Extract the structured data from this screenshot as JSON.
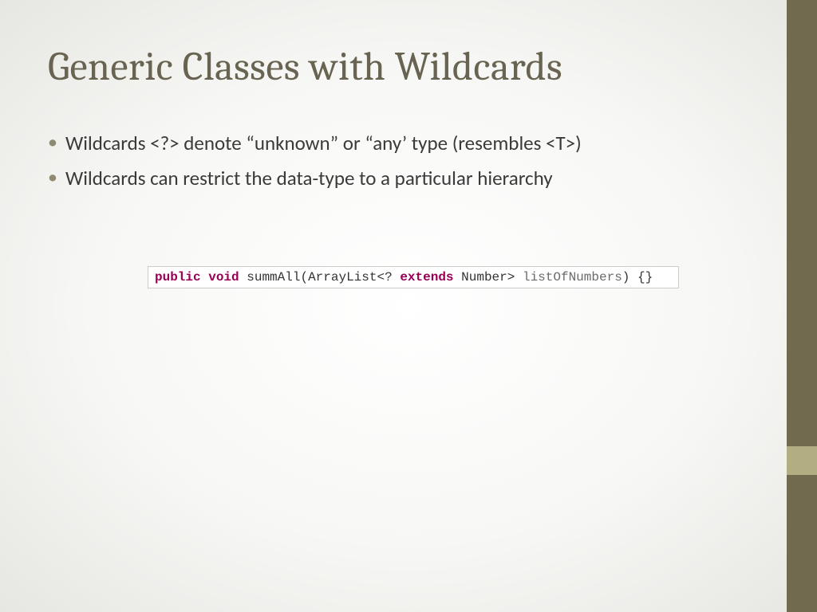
{
  "slide": {
    "title": "Generic Classes with Wildcards",
    "bullets": [
      "Wildcards <?> denote “unknown” or “any’ type (resembles <T>)",
      "Wildcards can restrict the data-type to a particular hierarchy"
    ],
    "code": {
      "kw1": "public",
      "kw2": "void",
      "method": "summAll",
      "open": "(",
      "type1": "ArrayList",
      "lt": "<",
      "q": "?",
      "kw3": "extends",
      "type2": "Number",
      "gt": ">",
      "param": "listOfNumbers",
      "close": ") {}"
    }
  }
}
